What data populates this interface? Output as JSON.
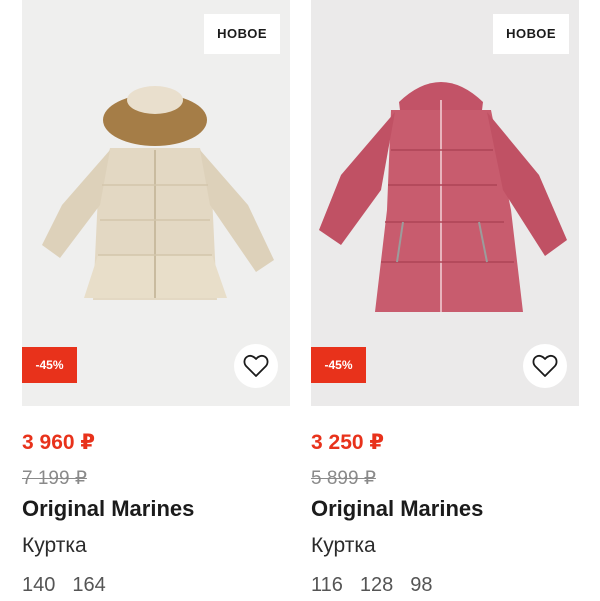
{
  "products": [
    {
      "badge_new": "НОВОЕ",
      "discount": "-45%",
      "price": "3 960 ₽",
      "old_price": "7 199 ₽",
      "brand": "Original Marines",
      "type": "Куртка",
      "sizes": [
        "140",
        "164"
      ],
      "jacket_color": "#e3d8c3",
      "icon": "heart-outline-icon"
    },
    {
      "badge_new": "НОВОЕ",
      "discount": "-45%",
      "price": "3 250 ₽",
      "old_price": "5 899 ₽",
      "brand": "Original Marines",
      "type": "Куртка",
      "sizes": [
        "116",
        "128",
        "98"
      ],
      "jacket_color": "#c85c6e",
      "icon": "heart-outline-icon"
    }
  ],
  "colors": {
    "accent": "#e8321b",
    "text": "#1b1b1b",
    "muted": "#8a8a8a"
  }
}
